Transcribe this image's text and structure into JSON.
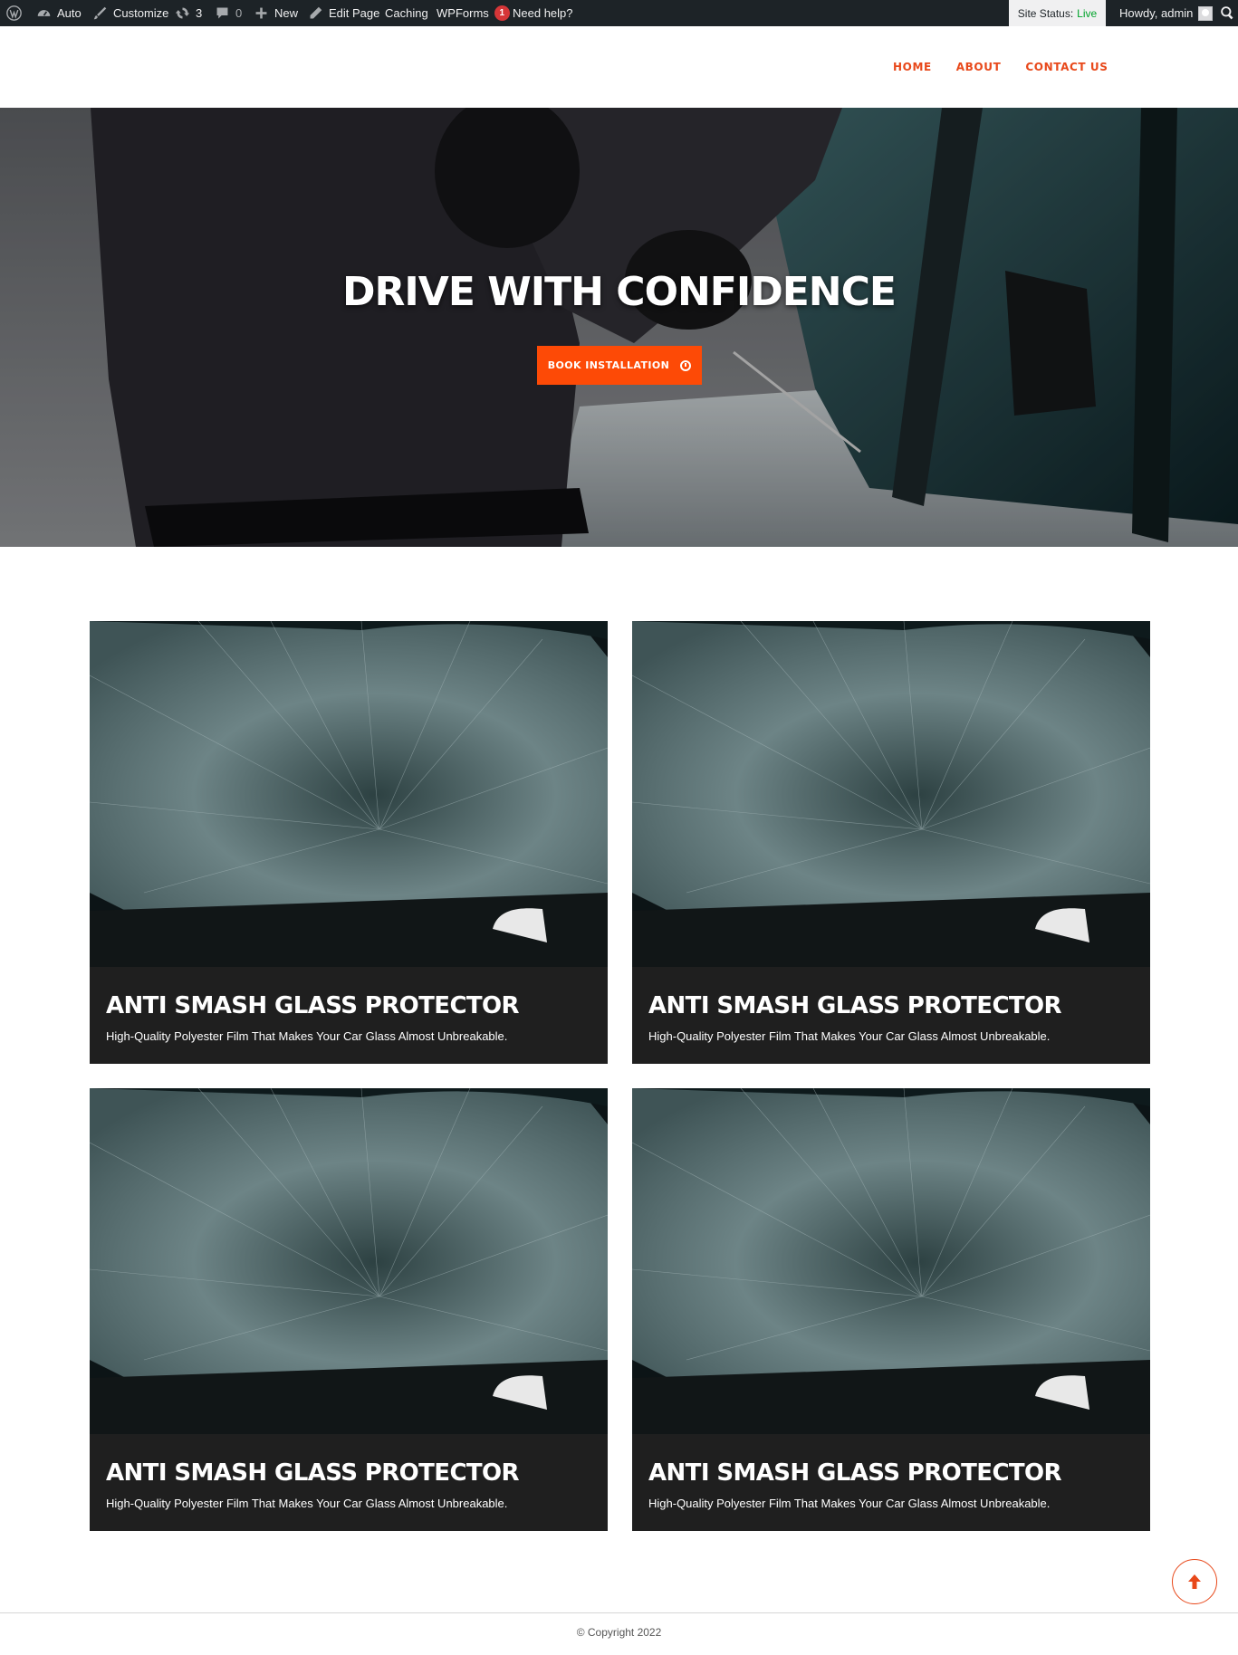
{
  "admin_bar": {
    "site_name": "Auto",
    "customize": "Customize",
    "updates_count": "3",
    "comments_count": "0",
    "new": "New",
    "edit_page": "Edit Page",
    "caching": "Caching",
    "wpforms": "WPForms",
    "wpforms_badge": "1",
    "need_help": "Need help?",
    "site_status_label": "Site Status:",
    "site_status_value": "Live",
    "howdy": "Howdy, admin"
  },
  "nav": {
    "items": [
      {
        "label": "HOME"
      },
      {
        "label": "ABOUT"
      },
      {
        "label": "CONTACT US"
      }
    ]
  },
  "hero": {
    "title": "DRIVE WITH CONFIDENCE",
    "button_label": "BOOK INSTALLATION",
    "button_icon": "clock-icon"
  },
  "cards": [
    {
      "title": "ANTI SMASH GLASS PROTECTOR",
      "description": "High-Quality Polyester Film That Makes Your Car Glass Almost Unbreakable."
    },
    {
      "title": "ANTI SMASH GLASS PROTECTOR",
      "description": "High-Quality Polyester Film That Makes Your Car Glass Almost Unbreakable."
    },
    {
      "title": "ANTI SMASH GLASS PROTECTOR",
      "description": "High-Quality Polyester Film That Makes Your Car Glass Almost Unbreakable."
    },
    {
      "title": "ANTI SMASH GLASS PROTECTOR",
      "description": "High-Quality Polyester Film That Makes Your Car Glass Almost Unbreakable."
    }
  ],
  "footer": {
    "copyright": "© Copyright 2022"
  },
  "colors": {
    "accent": "#fd4a06",
    "nav_link": "#e8481a",
    "admin_bar_bg": "#1d2327",
    "card_bg": "#1f1f1f"
  }
}
